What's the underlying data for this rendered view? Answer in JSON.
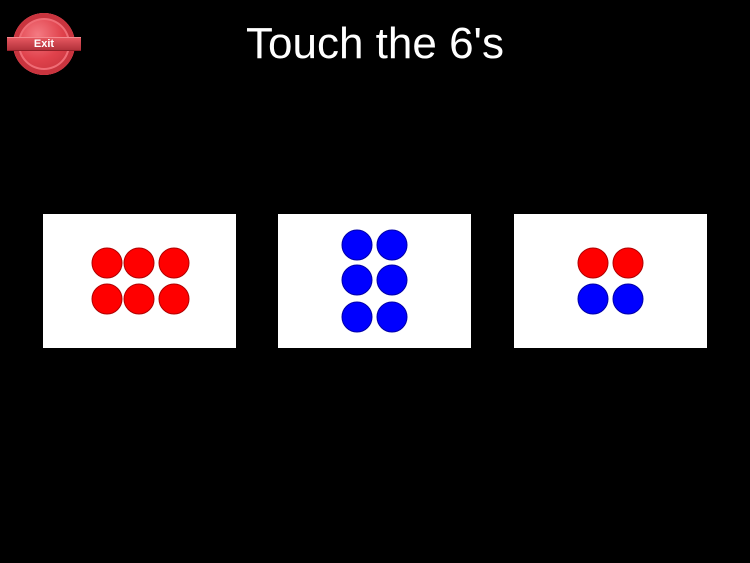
{
  "exit_button": {
    "label": "Exit",
    "color": "#e0424c"
  },
  "title": "Touch the 6's",
  "colors": {
    "red": "#ff0000",
    "blue": "#0000ff",
    "card": "#ffffff",
    "background": "#000000"
  },
  "cards": [
    {
      "dots": [
        "red",
        "red",
        "red",
        "red",
        "red",
        "red"
      ],
      "count": 6
    },
    {
      "dots": [
        "blue",
        "blue",
        "blue",
        "blue",
        "blue",
        "blue"
      ],
      "count": 6
    },
    {
      "dots": [
        "red",
        "red",
        "blue",
        "blue"
      ],
      "count": 4
    }
  ]
}
